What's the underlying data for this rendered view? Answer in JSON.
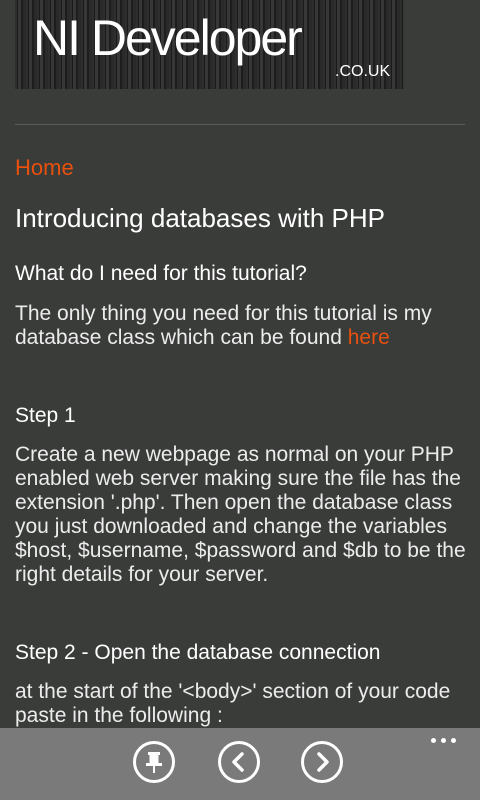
{
  "logo": {
    "main": "NI Developer",
    "sub": ".CO.UK"
  },
  "nav": {
    "home_label": "Home"
  },
  "article": {
    "title": "Introducing databases with PHP",
    "question_heading": "What do I need for this tutorial?",
    "intro_text": "The only thing you need for this tutorial is my database class which can be found ",
    "intro_link": "here",
    "step1_heading": "Step 1",
    "step1_text": "Create a new webpage as normal on your PHP enabled web server making sure the file has the extension '.php'. Then open the database class you just downloaded and change the variables $host, $username, $password and $db to be the right details for your server.",
    "step2_heading": "Step 2 - Open the database connection",
    "step2_text": "at the start of the '<body>' section of your code paste in the following :"
  },
  "appbar": {
    "buttons": [
      {
        "icon": "pin-icon"
      },
      {
        "icon": "back-arrow-icon"
      },
      {
        "icon": "forward-arrow-icon"
      }
    ],
    "more_icon": "more-ellipsis-icon"
  }
}
